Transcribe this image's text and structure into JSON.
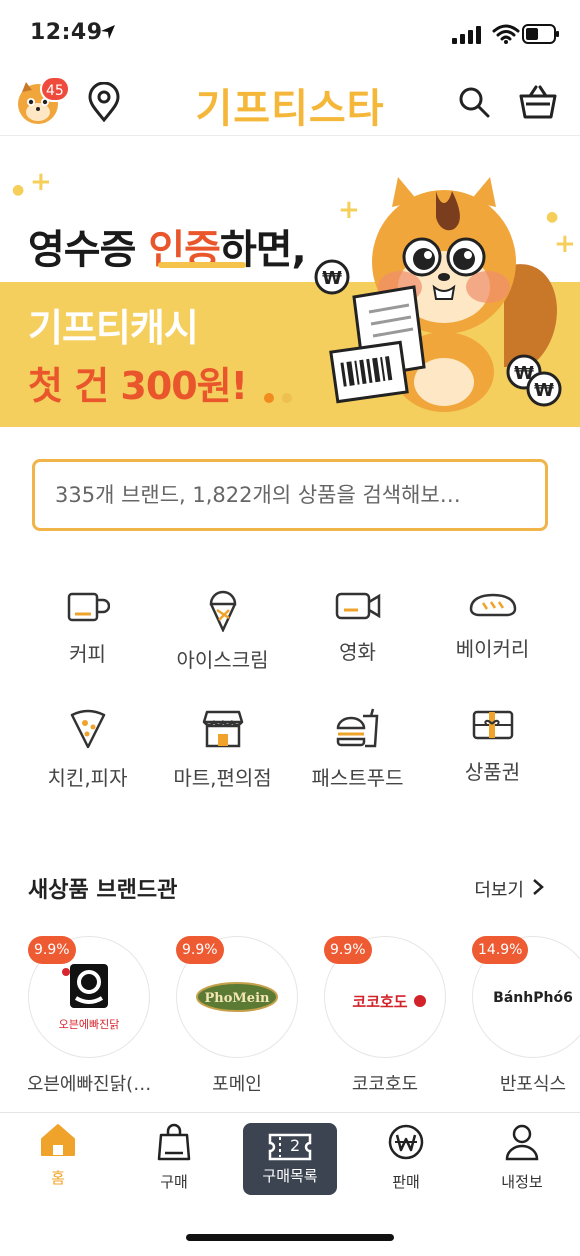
{
  "status_bar": {
    "time": "12:49"
  },
  "header": {
    "logo": "기프티스타",
    "notification_count": "45"
  },
  "banner": {
    "line1_pre": "영수증 ",
    "line1_highlight": "인증",
    "line1_post": "하면,",
    "line2": "기프티캐시",
    "line3": "첫 건 300원!",
    "slide_count": 2,
    "active_slide": 0
  },
  "search": {
    "placeholder": "335개 브랜드, 1,822개의 상품을 검색해보…"
  },
  "categories": [
    {
      "label": "커피",
      "icon": "coffee-cup-icon"
    },
    {
      "label": "아이스크림",
      "icon": "ice-cream-icon"
    },
    {
      "label": "영화",
      "icon": "movie-camera-icon"
    },
    {
      "label": "베이커리",
      "icon": "bread-icon"
    },
    {
      "label": "치킨,피자",
      "icon": "pizza-slice-icon"
    },
    {
      "label": "마트,편의점",
      "icon": "store-icon"
    },
    {
      "label": "패스트푸드",
      "icon": "burger-icon"
    },
    {
      "label": "상품권",
      "icon": "gift-card-icon"
    }
  ],
  "new_brands": {
    "title": "새상품 브랜드관",
    "more_label": "더보기",
    "items": [
      {
        "name": "오븐에빠진닭(…",
        "rate": "9.9%",
        "logo_text": "오븐에빠진닭"
      },
      {
        "name": "포메인",
        "rate": "9.9%",
        "logo_text": "PhoMein"
      },
      {
        "name": "코코호도",
        "rate": "9.9%",
        "logo_text": "코코호도"
      },
      {
        "name": "반포식스",
        "rate": "14.9%",
        "logo_text": "BánhPhó6"
      }
    ]
  },
  "tabbar": {
    "items": [
      {
        "label": "홈",
        "icon": "home-icon",
        "active": true
      },
      {
        "label": "구매",
        "icon": "shopping-bag-icon"
      },
      {
        "label": "구매목록",
        "icon": "ticket-icon",
        "count": "2"
      },
      {
        "label": "판매",
        "icon": "won-coin-icon"
      },
      {
        "label": "내정보",
        "icon": "person-icon"
      }
    ]
  },
  "colors": {
    "brand_yellow": "#f5b73a",
    "accent_orange": "#e9562c",
    "badge_red": "#ef4b3d",
    "tab_dark": "#3b4450"
  }
}
